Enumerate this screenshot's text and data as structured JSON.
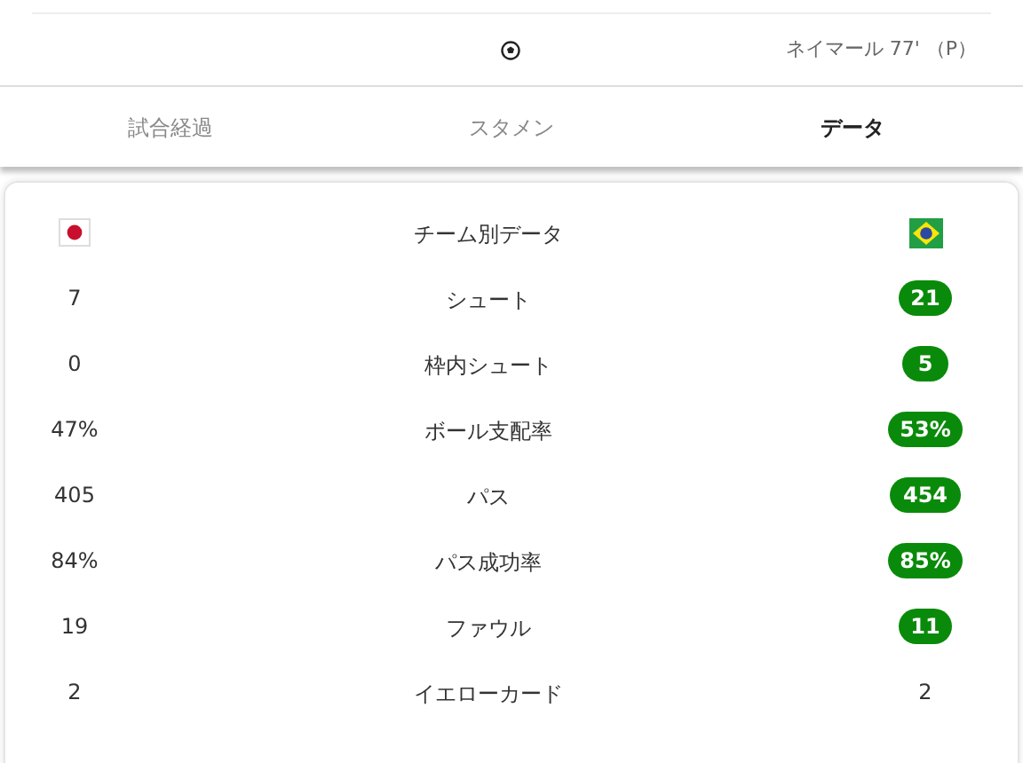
{
  "goal": {
    "scorer": "ネイマール 77' （P）"
  },
  "tabs": [
    {
      "label": "試合経過",
      "selected": false
    },
    {
      "label": "スタメン",
      "selected": false
    },
    {
      "label": "データ",
      "selected": true
    }
  ],
  "stats": {
    "title": "チーム別データ",
    "rows": [
      {
        "label": "シュート",
        "home": {
          "value": "7",
          "highlighted": false
        },
        "away": {
          "value": "21",
          "highlighted": true
        }
      },
      {
        "label": "枠内シュート",
        "home": {
          "value": "0",
          "highlighted": false
        },
        "away": {
          "value": "5",
          "highlighted": true
        }
      },
      {
        "label": "ボール支配率",
        "home": {
          "value": "47%",
          "highlighted": false
        },
        "away": {
          "value": "53%",
          "highlighted": true
        }
      },
      {
        "label": "パス",
        "home": {
          "value": "405",
          "highlighted": false
        },
        "away": {
          "value": "454",
          "highlighted": true
        }
      },
      {
        "label": "パス成功率",
        "home": {
          "value": "84%",
          "highlighted": false
        },
        "away": {
          "value": "85%",
          "highlighted": true
        }
      },
      {
        "label": "ファウル",
        "home": {
          "value": "19",
          "highlighted": false
        },
        "away": {
          "value": "11",
          "highlighted": true
        }
      },
      {
        "label": "イエローカード",
        "home": {
          "value": "2",
          "highlighted": false
        },
        "away": {
          "value": "2",
          "highlighted": false
        }
      }
    ]
  }
}
